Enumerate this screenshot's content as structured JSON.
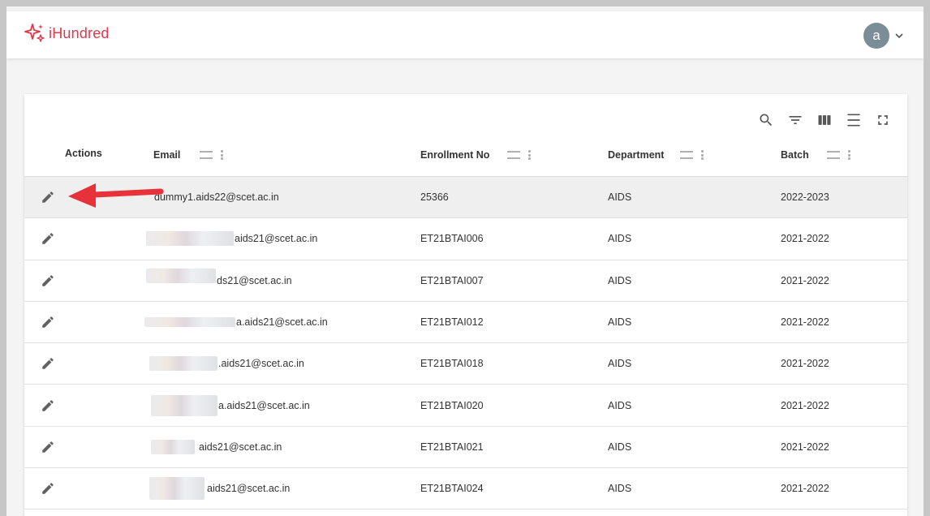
{
  "app": {
    "name": "iHundred",
    "brand_color": "#e0384a"
  },
  "user": {
    "initial": "a"
  },
  "toolbar": {
    "icons": [
      "search-icon",
      "filter-icon",
      "columns-icon",
      "density-icon",
      "fullscreen-icon"
    ]
  },
  "table": {
    "headers": {
      "actions": "Actions",
      "email": "Email",
      "enrollment": "Enrollment No",
      "department": "Department",
      "batch": "Batch"
    },
    "rows": [
      {
        "email": "dummy1.aids22@scet.ac.in",
        "enrollment": "25366",
        "department": "AIDS",
        "batch": "2022-2023"
      },
      {
        "email": "aids21@scet.ac.in",
        "enrollment": "ET21BTAI006",
        "department": "AIDS",
        "batch": "2021-2022"
      },
      {
        "email": "ds21@scet.ac.in",
        "enrollment": "ET21BTAI007",
        "department": "AIDS",
        "batch": "2021-2022"
      },
      {
        "email": "a.aids21@scet.ac.in",
        "enrollment": "ET21BTAI012",
        "department": "AIDS",
        "batch": "2021-2022"
      },
      {
        "email": ".aids21@scet.ac.in",
        "enrollment": "ET21BTAI018",
        "department": "AIDS",
        "batch": "2021-2022"
      },
      {
        "email": "a.aids21@scet.ac.in",
        "enrollment": "ET21BTAI020",
        "department": "AIDS",
        "batch": "2021-2022"
      },
      {
        "email": "aids21@scet.ac.in",
        "enrollment": "ET21BTAI021",
        "department": "AIDS",
        "batch": "2021-2022"
      },
      {
        "email": "aids21@scet.ac.in",
        "enrollment": "ET21BTAI024",
        "department": "AIDS",
        "batch": "2021-2022"
      }
    ]
  },
  "annotation": {
    "arrow_color": "#e8323a"
  }
}
